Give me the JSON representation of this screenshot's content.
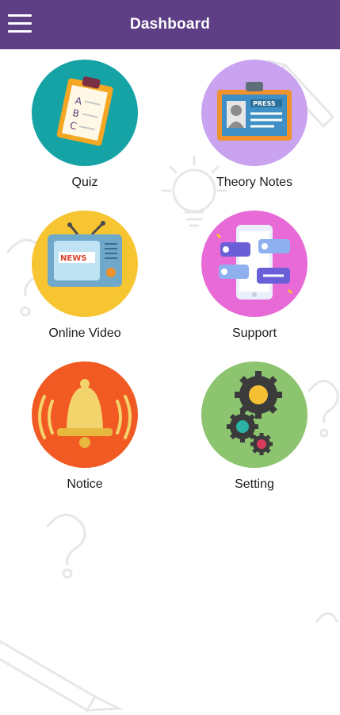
{
  "appbar": {
    "title": "Dashboard",
    "menu_icon": "hamburger-menu-icon",
    "color": "#5e3f86"
  },
  "tiles": [
    {
      "label": "Quiz",
      "icon": "clipboard-icon",
      "bg": "#16a3a6",
      "icon_text": "A B C"
    },
    {
      "label": "Theory Notes",
      "icon": "press-id-card-icon",
      "bg": "#c9a2f0",
      "icon_text": "PRESS"
    },
    {
      "label": "Online Video",
      "icon": "news-tv-icon",
      "bg": "#f7c531",
      "icon_text": "NEWS"
    },
    {
      "label": "Support",
      "icon": "chat-phone-icon",
      "bg": "#e86ad7"
    },
    {
      "label": "Notice",
      "icon": "bell-icon",
      "bg": "#f15a22"
    },
    {
      "label": "Setting",
      "icon": "gears-icon",
      "bg": "#8cc46f"
    }
  ]
}
